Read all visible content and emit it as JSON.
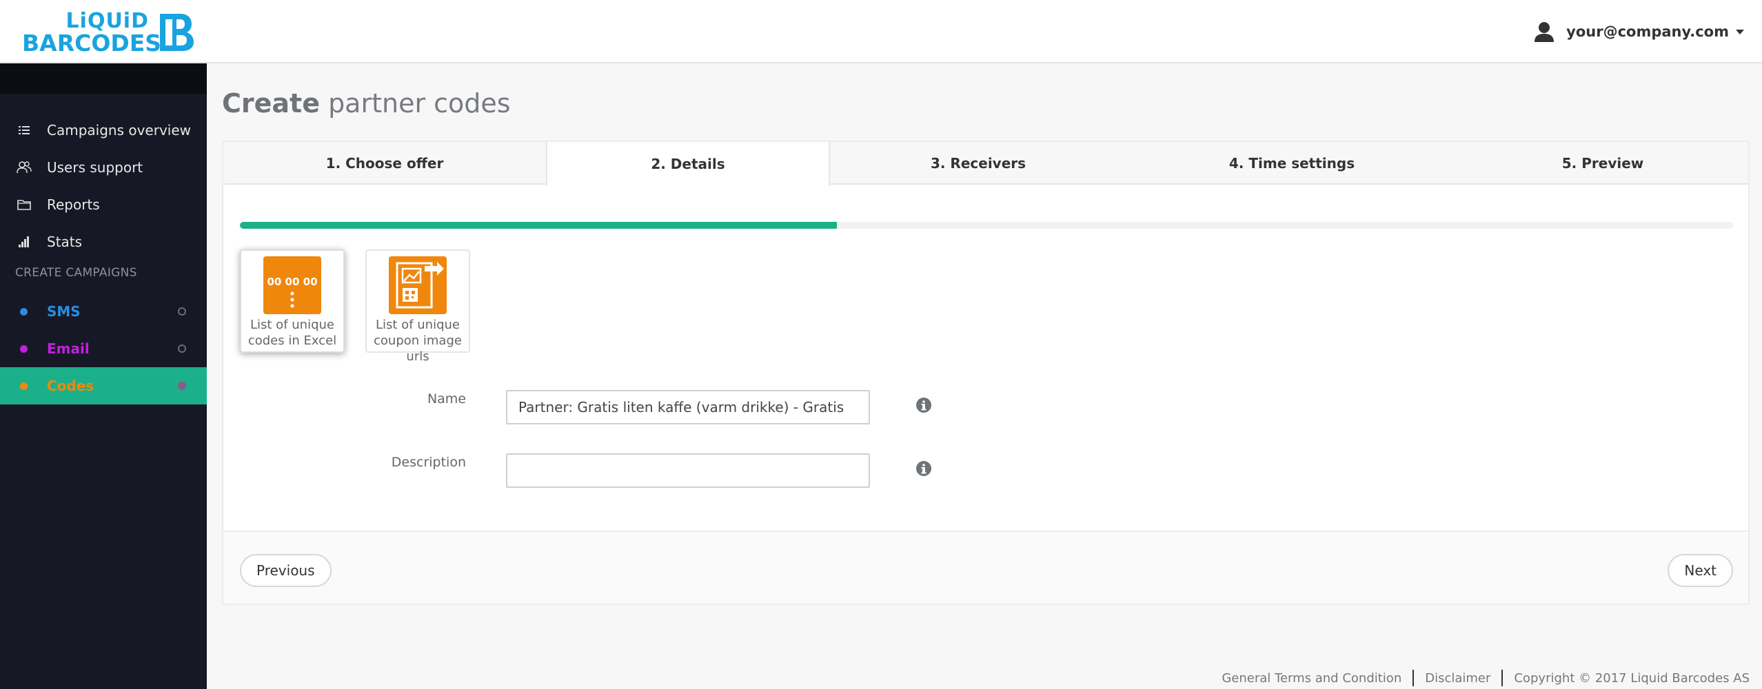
{
  "header": {
    "logo_line1": "LiQUiD",
    "logo_line2": "BARCODES",
    "user_email": "your@company.com"
  },
  "sidebar": {
    "items": [
      {
        "label": "Campaigns overview",
        "icon": "list-icon"
      },
      {
        "label": "Users support",
        "icon": "users-icon"
      },
      {
        "label": "Reports",
        "icon": "folder-icon"
      },
      {
        "label": "Stats",
        "icon": "bar-chart-icon"
      }
    ],
    "section_label": "CREATE CAMPAIGNS",
    "campaigns": [
      {
        "label": "SMS",
        "color": "#2a8de0"
      },
      {
        "label": "Email",
        "color": "#c21fe0"
      },
      {
        "label": "Codes",
        "color": "#f0870d",
        "active": true
      }
    ]
  },
  "main": {
    "title_bold": "Create",
    "title_rest": " partner codes",
    "tabs": [
      {
        "label": "1. Choose offer"
      },
      {
        "label": "2. Details",
        "active": true
      },
      {
        "label": "3. Receivers"
      },
      {
        "label": "4. Time settings"
      },
      {
        "label": "5. Preview"
      }
    ],
    "progress_fraction": 0.4,
    "code_types": [
      {
        "label": "List of unique codes in Excel",
        "tile_text": "00 00 00",
        "selected": true
      },
      {
        "label": "List of unique coupon image urls",
        "selected": false
      }
    ],
    "form": {
      "name_label": "Name",
      "name_value": "Partner: Gratis liten kaffe (varm drikke) - Gratis",
      "description_label": "Description",
      "description_value": ""
    },
    "buttons": {
      "previous": "Previous",
      "next": "Next"
    }
  },
  "footer": {
    "terms": "General Terms and Condition",
    "disclaimer": "Disclaimer",
    "copyright": "Copyright © 2017 Liquid Barcodes AS"
  },
  "colors": {
    "accent": "#1bb08a",
    "brand": "#19a3e0",
    "sidebar_bg": "#161925",
    "tile_orange": "#f0870d"
  }
}
